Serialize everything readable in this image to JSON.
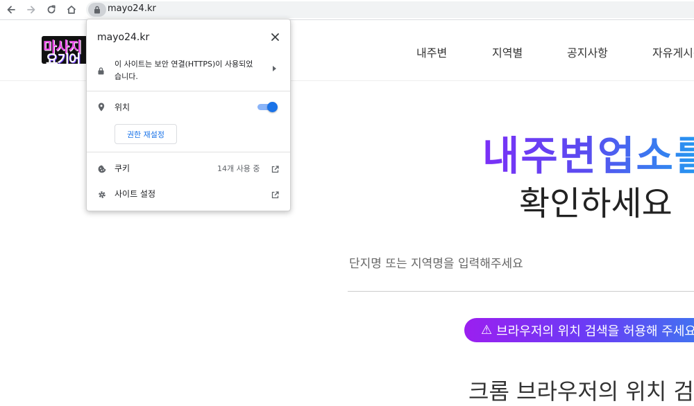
{
  "browser": {
    "url": "mayo24.kr",
    "icons": [
      "back-arrow-icon",
      "forward-arrow-icon",
      "reload-icon",
      "home-icon",
      "lock-icon"
    ]
  },
  "site": {
    "logo_line1": "마사지",
    "logo_line2": "요기어",
    "menu": [
      "내주변",
      "지역별",
      "공지사항",
      "자유게시판"
    ],
    "hero_title": "내주변업소를",
    "hero_subtitle": "확인하세요",
    "search_placeholder": "단지명 또는 지역명을 입력해주세요",
    "alert_text": "브라우저의 위치 검색을 허용해 주세요",
    "bottom_heading": "크롬 브라우저의 위치 검색"
  },
  "popup": {
    "host": "mayo24.kr",
    "secure_text": "이 사이트는 보안 연결(HTTPS)이 사용되었습니다.",
    "location_label": "위치",
    "location_enabled": true,
    "reset_button": "권한 재설정",
    "cookie_label": "쿠키",
    "cookie_count": "14개 사용 중",
    "settings_label": "사이트 설정"
  },
  "colors": {
    "accent": "#1a73e8",
    "toggle_track": "#8ab4f8",
    "hero_gradient_start": "#7b2ff7",
    "hero_gradient_end": "#1ea2f0"
  }
}
